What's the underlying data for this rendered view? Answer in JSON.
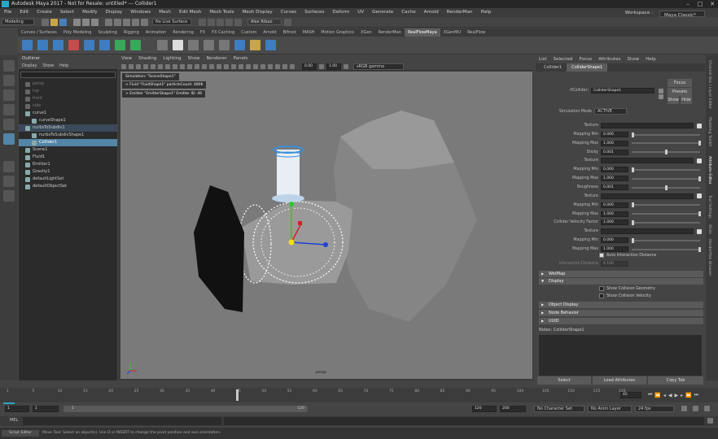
{
  "window": {
    "title": "Autodesk Maya 2017 - Not for Resale: untitled*  ---  Collider1"
  },
  "menubar": {
    "items": [
      "File",
      "Edit",
      "Create",
      "Select",
      "Modify",
      "Display",
      "Windows",
      "Mesh",
      "Edit Mesh",
      "Mesh Tools",
      "Mesh Display",
      "Curves",
      "Surfaces",
      "Deform",
      "UV",
      "Generate",
      "Cache",
      "Arnold",
      "RenderMan",
      "Help"
    ],
    "workspace_label": "Workspace :",
    "workspace_value": "Maya Classic*"
  },
  "statusline": {
    "mode": "Modeling",
    "live_surface": "No Live Surface",
    "user": "Alex Ribao"
  },
  "shelf": {
    "tabs": [
      "Curves / Surfaces",
      "Poly Modeling",
      "Sculpting",
      "Rigging",
      "Animation",
      "Rendering",
      "FX",
      "FX Caching",
      "Custom",
      "Arnold",
      "Bifrost",
      "MASH",
      "Motion Graphics",
      "XGen",
      "RenderMan",
      "RealFlowMaya",
      "XGenMU",
      "RealFlow"
    ],
    "active_index": 15
  },
  "outliner": {
    "title": "Outliner",
    "menu": [
      "Display",
      "Show",
      "Help"
    ],
    "items": [
      {
        "label": "persp",
        "indent": 1,
        "state": "dim"
      },
      {
        "label": "top",
        "indent": 1,
        "state": "dim"
      },
      {
        "label": "front",
        "indent": 1,
        "state": "dim"
      },
      {
        "label": "side",
        "indent": 1,
        "state": "dim"
      },
      {
        "label": "curve1",
        "indent": 1,
        "state": "normal"
      },
      {
        "label": "curveShape1",
        "indent": 2,
        "state": "normal"
      },
      {
        "label": "nurbsToSubdiv1",
        "indent": 1,
        "state": "hl"
      },
      {
        "label": "nurbsToSubdivShape1",
        "indent": 2,
        "state": "normal"
      },
      {
        "label": "Collider1",
        "indent": 2,
        "state": "sel"
      },
      {
        "label": "Scene1",
        "indent": 1,
        "state": "normal"
      },
      {
        "label": "Fluid1",
        "indent": 1,
        "state": "normal"
      },
      {
        "label": "Emitter1",
        "indent": 1,
        "state": "normal"
      },
      {
        "label": "Gravity1",
        "indent": 1,
        "state": "normal"
      },
      {
        "label": "defaultLightSet",
        "indent": 1,
        "state": "normal"
      },
      {
        "label": "defaultObjectSet",
        "indent": 1,
        "state": "normal"
      }
    ]
  },
  "viewport": {
    "menu": [
      "View",
      "Shading",
      "Lighting",
      "Show",
      "Renderer",
      "Panels"
    ],
    "near": "0.00",
    "far": "1.00",
    "colorspace": "sRGB gamma",
    "hud": [
      "Simulation: \"SceneShape1\"",
      "> Fluid \"FluidShape1\" particleCount: 4806",
      "> Emitter \"EmitterShape1\" Emitter ID: 49"
    ],
    "camera_label": "persp"
  },
  "attribute_editor": {
    "menu": [
      "List",
      "Selected",
      "Focus",
      "Attributes",
      "Show",
      "Help"
    ],
    "tabs": [
      "Collider1",
      "ColliderShape1"
    ],
    "active_tab": 1,
    "node_label": "rfCollider:",
    "node_value": "ColliderShape1",
    "focus": "Focus",
    "presets": "Presets",
    "show": "Show",
    "hide": "Hide",
    "simulation_mode_label": "Simulation Mode",
    "simulation_mode": "ACTIVE",
    "rows": [
      {
        "label": "Texture",
        "kind": "tex"
      },
      {
        "label": "Mapping Min",
        "value": "0.000",
        "pos": 0.0
      },
      {
        "label": "Mapping Max",
        "value": "1.000",
        "pos": 1.0
      },
      {
        "label": "Sticky",
        "value": "0.001",
        "pos": 0.5
      },
      {
        "label": "Texture",
        "kind": "tex"
      },
      {
        "label": "Mapping Min",
        "value": "0.000",
        "pos": 0.0
      },
      {
        "label": "Mapping Max",
        "value": "1.000",
        "pos": 1.0
      },
      {
        "label": "Roughness",
        "value": "0.001",
        "pos": 0.5
      },
      {
        "label": "Texture",
        "kind": "tex"
      },
      {
        "label": "Mapping Min",
        "value": "0.000",
        "pos": 0.0
      },
      {
        "label": "Mapping Max",
        "value": "1.000",
        "pos": 1.0
      },
      {
        "label": "Collider Velocity Factor",
        "value": "1.000",
        "pos": 0.0
      },
      {
        "label": "Texture",
        "kind": "tex"
      },
      {
        "label": "Mapping Min",
        "value": "0.000",
        "pos": 0.0
      },
      {
        "label": "Mapping Max",
        "value": "1.000",
        "pos": 1.0
      }
    ],
    "auto_interaction": "Auto Interaction Distance",
    "interaction_distance_label": "Interaction Distance",
    "interaction_distance": "0.100",
    "sections": [
      "WetMap",
      "Display",
      "Object Display",
      "Node Behavior",
      "UUID"
    ],
    "display_checks": [
      "Show Collision Geometry",
      "Show Collision Velocity"
    ],
    "notes": "Notes:  ColliderShape1",
    "buttons": [
      "Select",
      "Load Attributes",
      "Copy Tab"
    ]
  },
  "side_tabs": [
    "Channel Box / Layer Editor",
    "Modeling Toolkit",
    "Attribute Editor",
    "Tool Settings",
    "XGen",
    "RenderMan Browser"
  ],
  "timeline": {
    "ticks": [
      "1",
      "5",
      "10",
      "15",
      "20",
      "25",
      "30",
      "35",
      "40",
      "45",
      "50",
      "55",
      "60",
      "65",
      "70",
      "75",
      "80",
      "85",
      "90",
      "95",
      "100",
      "105",
      "110",
      "115",
      "120"
    ],
    "current_frame": "45"
  },
  "range": {
    "start": "1",
    "start2": "1",
    "slider_start": "1",
    "slider_end": "120",
    "end": "120",
    "end2": "200",
    "character_set": "No Character Set",
    "anim_layer": "No Anim Layer",
    "fps": "24 fps"
  },
  "cmdline": {
    "label": "MEL"
  },
  "helpline": {
    "text": "Move Tool: Select an object(s). Use D or INSERT to change the pivot position and axis orientation.",
    "script_tab": "Script Editor"
  }
}
